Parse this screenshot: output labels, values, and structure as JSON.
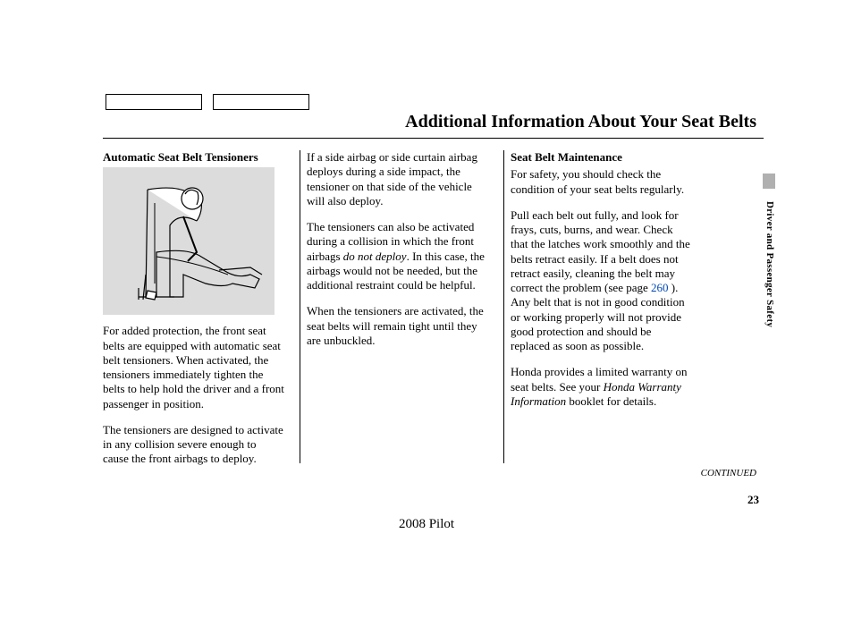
{
  "title": "Additional Information About Your Seat Belts",
  "col1": {
    "heading": "Automatic Seat Belt Tensioners",
    "p1": "For added protection, the front seat belts are equipped with automatic seat belt tensioners. When activated, the tensioners immediately tighten the belts to help hold the driver and a front passenger in position.",
    "p2": "The tensioners are designed to activate in any collision severe enough to cause the front airbags to deploy."
  },
  "col2": {
    "p1a": "If a side airbag or side curtain airbag deploys during a side impact, the tensioner on that side of the vehicle will also deploy.",
    "p2a": "The tensioners can also be activated during a collision in which the front airbags ",
    "p2_italic": "do not deploy",
    "p2b": ". In this case, the airbags would not be needed, but the additional restraint could be helpful.",
    "p3": "When the tensioners are activated, the seat belts will remain tight until they are unbuckled."
  },
  "col3": {
    "heading": "Seat Belt Maintenance",
    "p1": "For safety, you should check the condition of your seat belts regularly.",
    "p2a": "Pull each belt out fully, and look for frays, cuts, burns, and wear. Check that the latches work smoothly and the belts retract easily. If a belt does not retract easily, cleaning the belt may correct the problem (see page ",
    "page_ref": "260",
    "p2b": " ). Any belt that is not in good condition or working properly will not provide good protection and should be replaced as soon as possible.",
    "p3a": "Honda provides a limited warranty on seat belts. See your ",
    "p3_italic": "Honda Warranty Information",
    "p3b": " booklet for details."
  },
  "side_label": "Driver and Passenger Safety",
  "continued": "CONTINUED",
  "page_number": "23",
  "footer_model": "2008  Pilot"
}
